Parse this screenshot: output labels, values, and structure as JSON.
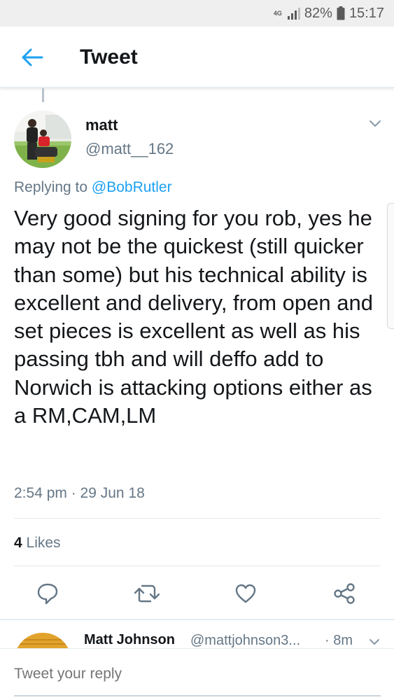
{
  "status_bar": {
    "network_type": "4G",
    "battery_percent": "82%",
    "time": "15:17",
    "icons": [
      "signal-icon",
      "battery-icon"
    ]
  },
  "header": {
    "back_icon": "arrow-left-icon",
    "title": "Tweet"
  },
  "tweet": {
    "author_name": "matt",
    "author_handle": "@matt__162",
    "replying_prefix": "Replying to ",
    "replying_to": "@BobRutler",
    "text": "Very good signing for you rob, yes he may not be the quickest (still quicker than some) but his technical ability is excellent and delivery, from open and set pieces is excellent as well as his passing tbh and will deffo add to Norwich is attacking options either as a RM,CAM,LM",
    "timestamp": "2:54 pm · 29 Jun 18",
    "likes_count": "4",
    "likes_label": " Likes",
    "actions": [
      "reply-icon",
      "retweet-icon",
      "like-icon",
      "share-icon"
    ]
  },
  "next_reply": {
    "name": "Matt Johnson",
    "handle": "@mattjohnson3...",
    "time": "· 8m"
  },
  "compose": {
    "placeholder": "Tweet your reply"
  },
  "colors": {
    "accent": "#1da1f2",
    "secondary_text": "#657786",
    "primary_text": "#14171a"
  }
}
